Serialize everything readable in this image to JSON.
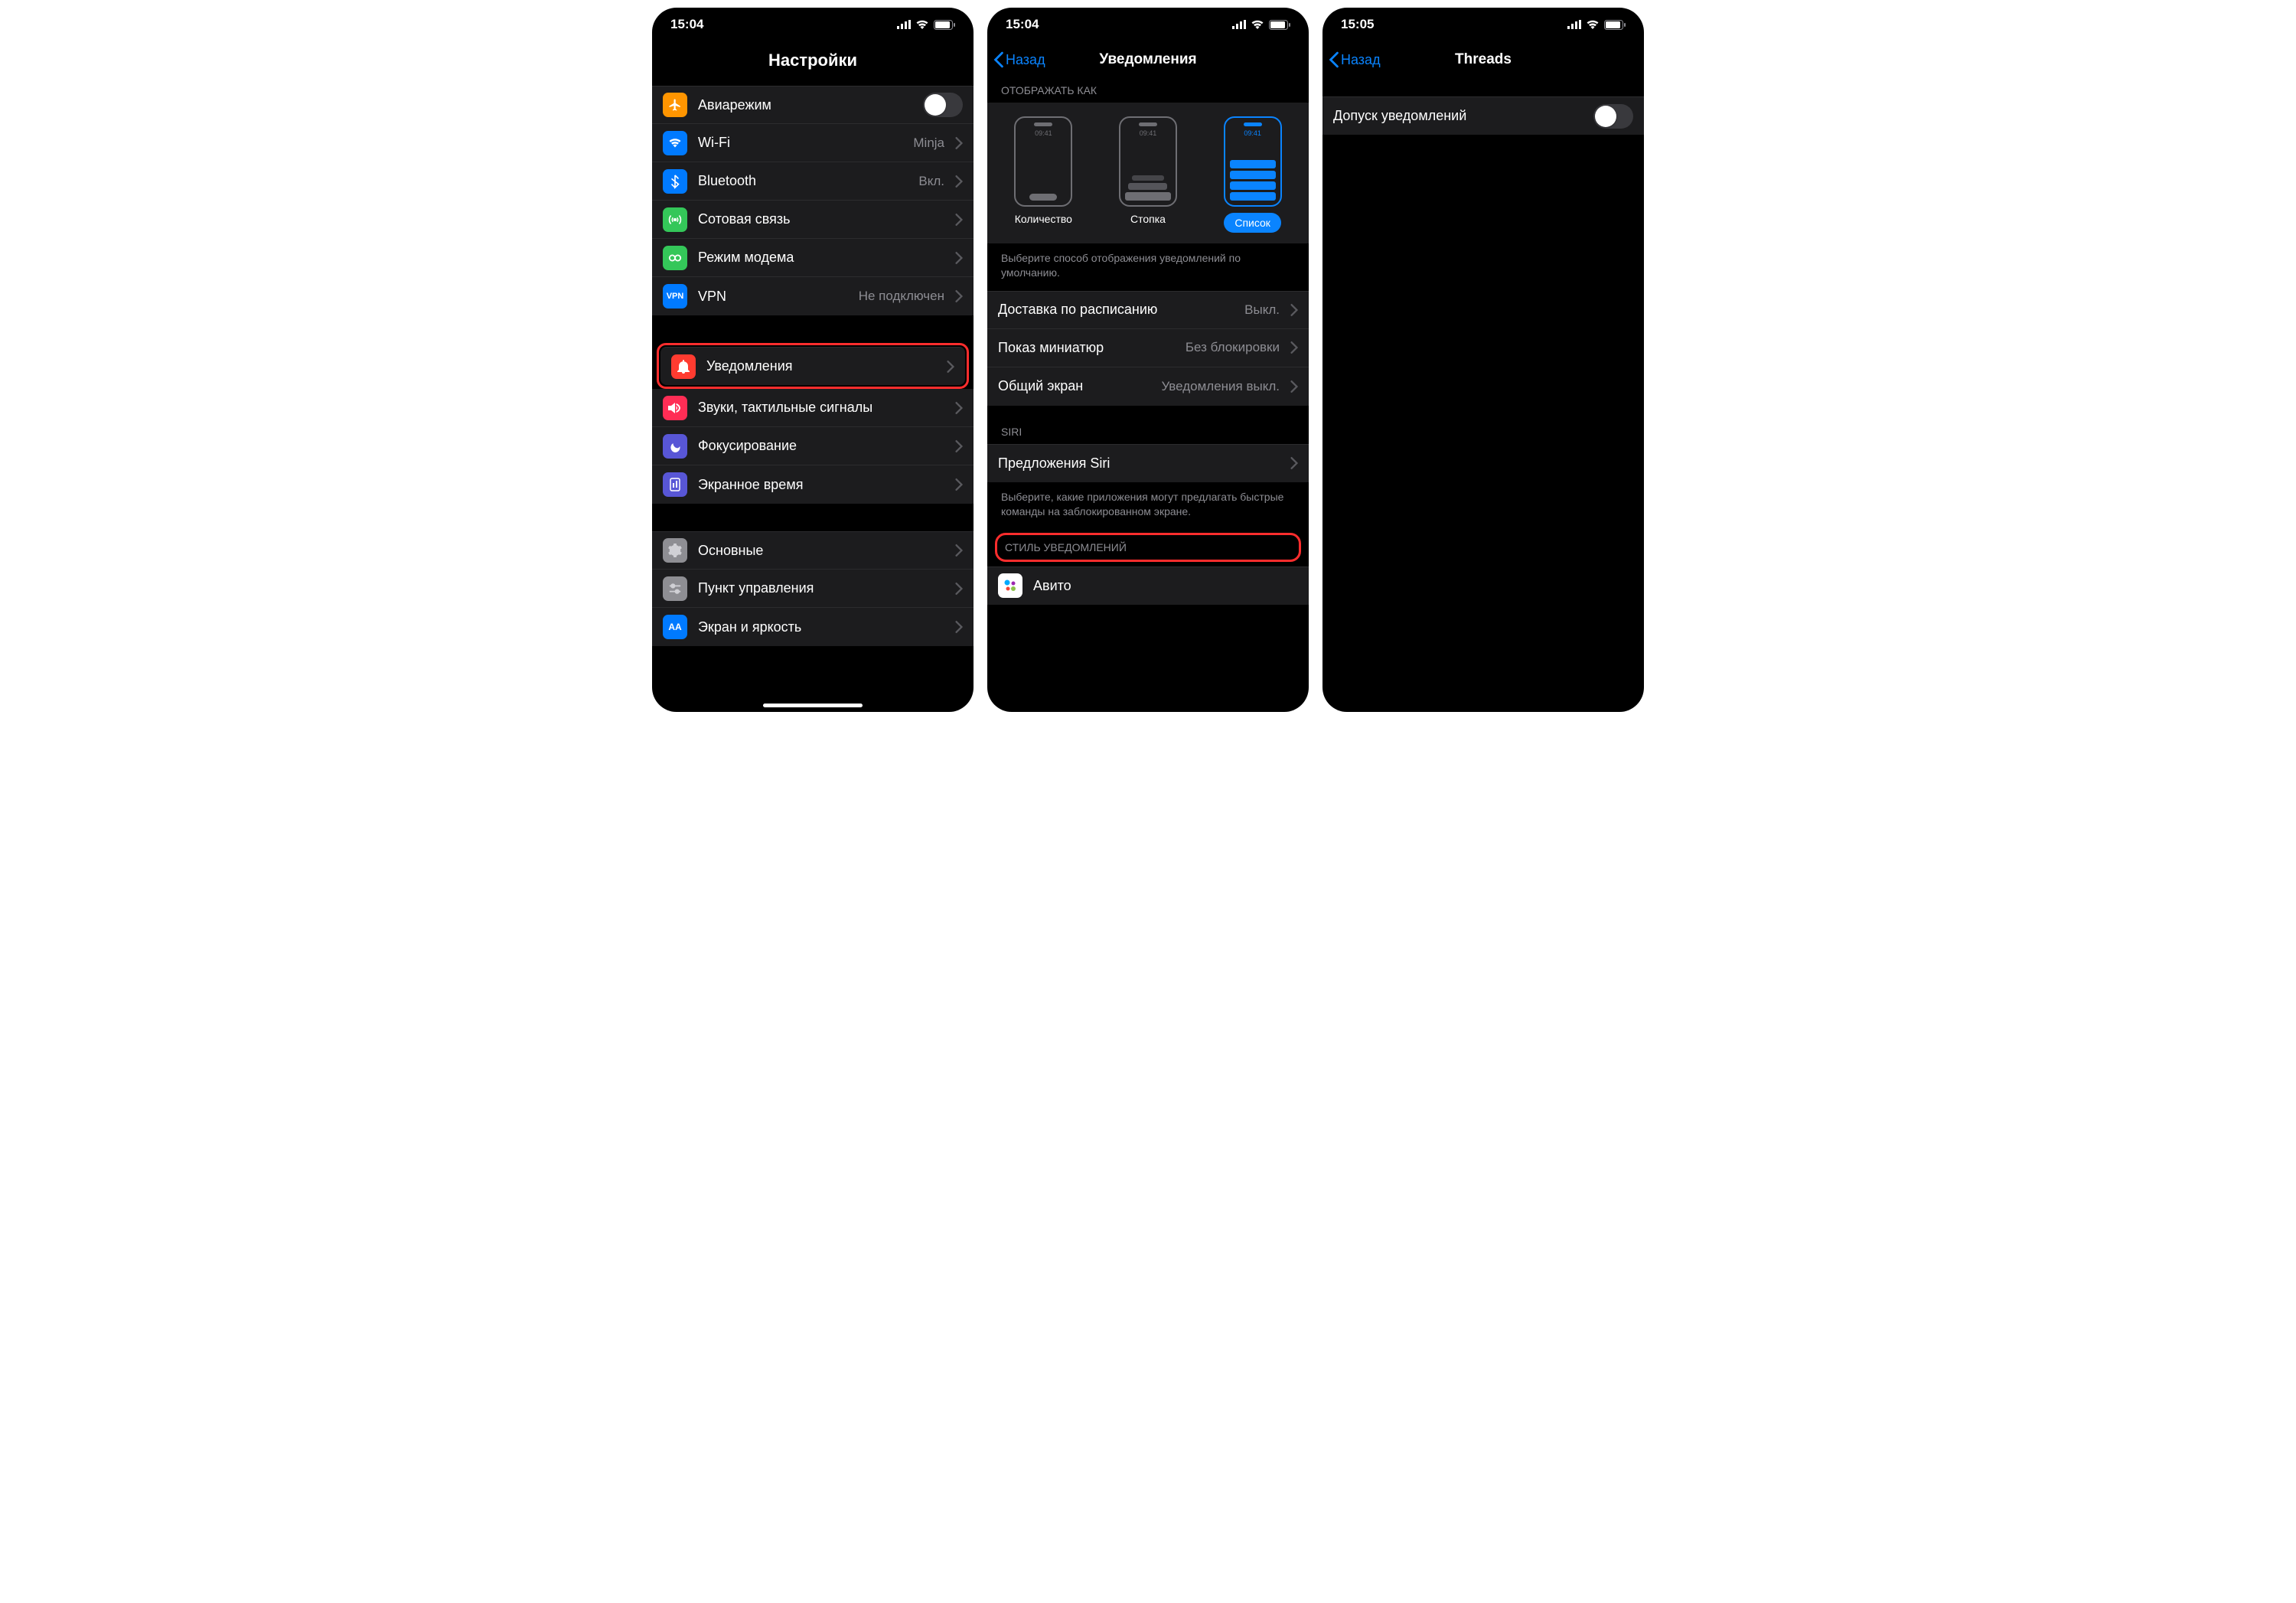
{
  "statusbar": {
    "time_a": "15:04",
    "time_b": "15:04",
    "time_c": "15:05"
  },
  "screen1": {
    "title": "Настройки",
    "rows_group1": [
      {
        "icon": "airplane",
        "label": "Авиарежим",
        "value": "",
        "toggle": false
      },
      {
        "icon": "wifi",
        "label": "Wi-Fi",
        "value": "Minja"
      },
      {
        "icon": "bluetooth",
        "label": "Bluetooth",
        "value": "Вкл."
      },
      {
        "icon": "cellular",
        "label": "Сотовая связь",
        "value": ""
      },
      {
        "icon": "hotspot",
        "label": "Режим модема",
        "value": ""
      },
      {
        "icon": "vpn",
        "label": "VPN",
        "value": "Не подключен"
      }
    ],
    "rows_group2": [
      {
        "icon": "bell",
        "label": "Уведомления",
        "value": "",
        "highlight": true
      },
      {
        "icon": "sounds",
        "label": "Звуки, тактильные сигналы",
        "value": ""
      },
      {
        "icon": "focus",
        "label": "Фокусирование",
        "value": ""
      },
      {
        "icon": "screentime",
        "label": "Экранное время",
        "value": ""
      }
    ],
    "rows_group3": [
      {
        "icon": "general",
        "label": "Основные",
        "value": ""
      },
      {
        "icon": "control",
        "label": "Пункт управления",
        "value": ""
      },
      {
        "icon": "display",
        "label": "Экран и яркость",
        "value": ""
      }
    ]
  },
  "screen2": {
    "back": "Назад",
    "title": "Уведомления",
    "header_displayas": "ОТОБРАЖАТЬ КАК",
    "tiles": [
      {
        "key": "count",
        "caption": "Количество"
      },
      {
        "key": "stack",
        "caption": "Стопка"
      },
      {
        "key": "list",
        "caption": "Список",
        "active": true
      }
    ],
    "mock_time": "09:41",
    "footer_displayas": "Выберите способ отображения уведомлений по умолчанию.",
    "rows_delivery": [
      {
        "label": "Доставка по расписанию",
        "value": "Выкл."
      },
      {
        "label": "Показ миниатюр",
        "value": "Без блокировки"
      },
      {
        "label": "Общий экран",
        "value": "Уведомления выкл."
      }
    ],
    "header_siri": "SIRI",
    "row_siri": {
      "label": "Предложения Siri"
    },
    "footer_siri": "Выберите, какие приложения могут предлагать быстрые команды на заблокированном экране.",
    "header_style": "СТИЛЬ УВЕДОМЛЕНИЙ",
    "row_app": {
      "label": "Авито"
    }
  },
  "screen3": {
    "back": "Назад",
    "title": "Threads",
    "row": {
      "label": "Допуск уведомлений",
      "toggle": false
    }
  }
}
